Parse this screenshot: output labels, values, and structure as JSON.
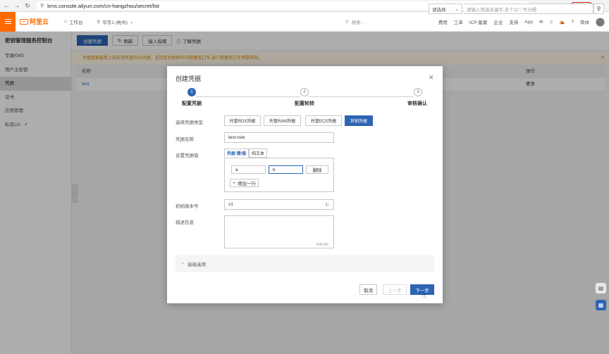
{
  "browser": {
    "url": "kms.console.aliyun.com/cn-hangzhou/secret/list",
    "update_label": "更新"
  },
  "topnav": {
    "logo_text": "阿里云",
    "workbench": "工作台",
    "region": "华东1 (杭州)",
    "search_placeholder": "搜索...",
    "right_links": [
      "费用",
      "工单",
      "ICP 备案",
      "企业",
      "支持",
      "App"
    ],
    "lang": "简体"
  },
  "sidebar": {
    "title": "密钥管理服务控制台",
    "items": [
      {
        "label": "专属KMS"
      },
      {
        "label": "用户主密钥"
      },
      {
        "label": "凭据"
      },
      {
        "label": "证书"
      },
      {
        "label": "应用管理"
      },
      {
        "label": "私有CA"
      }
    ]
  },
  "toolbar": {
    "create_label": "创建凭据",
    "refresh_label": "刷新",
    "access_label": "接入指南",
    "learn_label": "了解凭据",
    "filter_select": "请选择",
    "search_placeholder": "请输入筛选关键字,多个以\",\"号分隔"
  },
  "notice": {
    "text": "凭据管家最新上线支持托管RDS凭据、支持定时更新RDS数据库口令,减少数据库口令泄露风险。"
  },
  "table": {
    "headers": [
      "名称",
      "操作"
    ],
    "rows": [
      {
        "name": "test",
        "action": "更多"
      }
    ]
  },
  "modal": {
    "title": "创建凭据",
    "steps": [
      {
        "num": "1",
        "label": "配置凭据",
        "active": true
      },
      {
        "num": "2",
        "label": "配置轮转",
        "active": false
      },
      {
        "num": "3",
        "label": "审核确认",
        "active": false
      }
    ],
    "type_label": "选择凭据类型",
    "types": [
      "托管RDS凭据",
      "托管RAM凭据",
      "托管ECS凭据",
      "其他凭据"
    ],
    "selected_type": "其他凭据",
    "name_label": "凭据名称",
    "name_value": "test-rule",
    "value_label": "设置凭据值",
    "value_tabs": [
      "凭据 键/值",
      "纯文本"
    ],
    "kv_key": "a",
    "kv_value": "b",
    "delete_label": "删除",
    "add_row_label": "增加一行",
    "version_label": "初始版本号",
    "version_value": "v1",
    "desc_label": "描述信息",
    "desc_counter": "0/8192",
    "advanced_label": "高级选项",
    "cancel_label": "取消",
    "prev_label": "上一步",
    "next_label": "下一步"
  },
  "colors": {
    "primary": "#2d64b3",
    "brand_orange": "#ff6a00",
    "notice_text": "#d48806"
  }
}
